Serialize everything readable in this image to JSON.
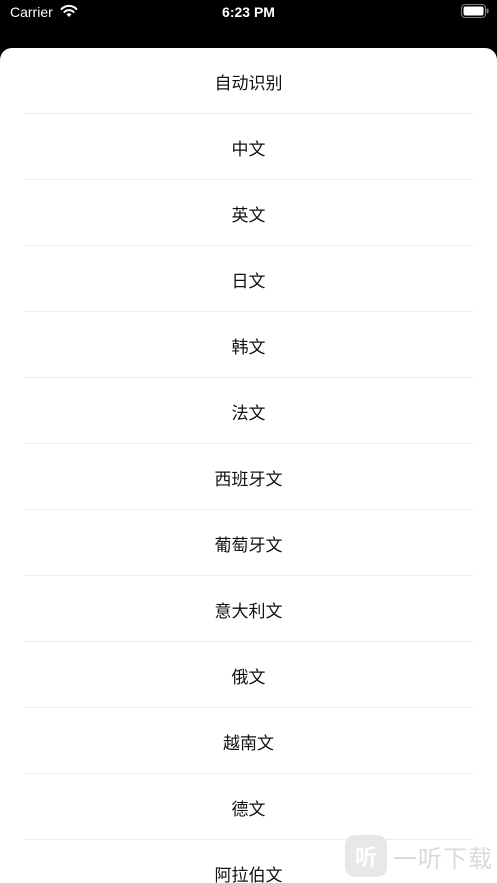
{
  "status_bar": {
    "carrier": "Carrier",
    "time": "6:23 PM",
    "icons": [
      "wifi-icon",
      "battery-icon"
    ]
  },
  "language_list": {
    "items": [
      "自动识别",
      "中文",
      "英文",
      "日文",
      "韩文",
      "法文",
      "西班牙文",
      "葡萄牙文",
      "意大利文",
      "俄文",
      "越南文",
      "德文",
      "阿拉伯文"
    ]
  },
  "watermark": {
    "logo_glyph": "听",
    "text": "一听下载"
  },
  "colors": {
    "status_bar_bg": "#000000",
    "sheet_bg": "#ffffff",
    "divider": "#ededed",
    "text": "#111111"
  }
}
